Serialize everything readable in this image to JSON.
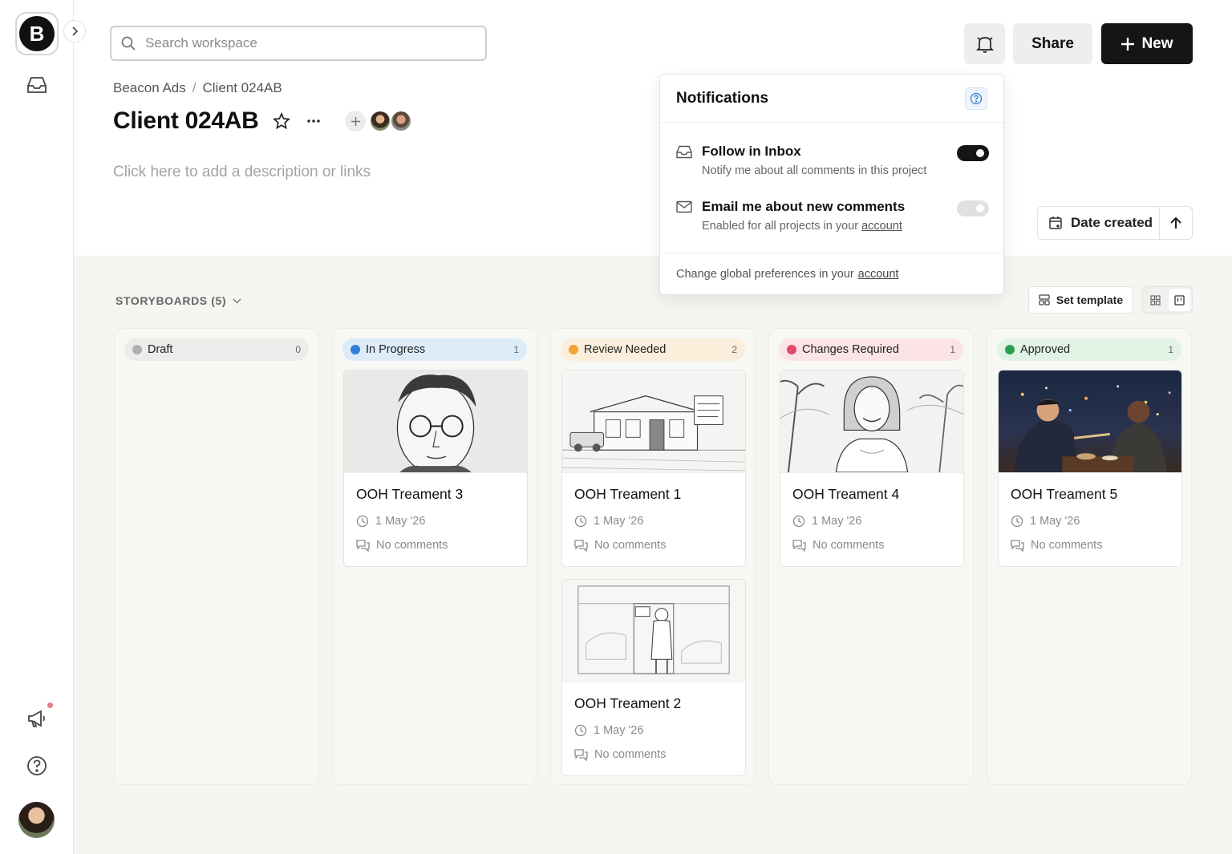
{
  "sidebar": {
    "logo_letter": "B",
    "items": [
      {
        "icon": "inbox-icon"
      },
      {
        "icon": "megaphone-icon",
        "has_badge": true
      },
      {
        "icon": "help-icon"
      },
      {
        "icon": "user-avatar"
      }
    ]
  },
  "header": {
    "search_placeholder": "Search workspace",
    "share_label": "Share",
    "new_label": "New",
    "breadcrumb": [
      "Beacon Ads",
      "Client 024AB"
    ],
    "title": "Client 024AB",
    "description_placeholder": "Click here to add a description or links",
    "sort_label": "Date created"
  },
  "notifications": {
    "title": "Notifications",
    "rows": [
      {
        "title": "Follow in Inbox",
        "subtitle": "Notify me about all comments in this project",
        "enabled": true
      },
      {
        "title": "Email me about new comments",
        "subtitle": "Enabled for all projects in your",
        "link": "account",
        "enabled": false
      }
    ],
    "footer_text": "Change global preferences in your",
    "footer_link": "account"
  },
  "board": {
    "title": "STORYBOARDS (5)",
    "set_template_label": "Set template",
    "columns": [
      {
        "label": "Draft",
        "count": "0",
        "dot": "#b0b0b0",
        "bg": "#ececea",
        "cards": []
      },
      {
        "label": "In Progress",
        "count": "1",
        "dot": "#2f7fd6",
        "bg": "#dcebf8",
        "cards": [
          {
            "title": "OOH Treament 3",
            "date": "1 May '26",
            "comments": "No comments"
          }
        ]
      },
      {
        "label": "Review Needed",
        "count": "2",
        "dot": "#f0a531",
        "bg": "#fbeedb",
        "cards": [
          {
            "title": "OOH Treament 1",
            "date": "1 May '26",
            "comments": "No comments"
          },
          {
            "title": "OOH Treament 2",
            "date": "1 May '26",
            "comments": "No comments"
          }
        ]
      },
      {
        "label": "Changes Required",
        "count": "1",
        "dot": "#e04a6c",
        "bg": "#fbe3e7",
        "cards": [
          {
            "title": "OOH Treament 4",
            "date": "1 May '26",
            "comments": "No comments"
          }
        ]
      },
      {
        "label": "Approved",
        "count": "1",
        "dot": "#2a9e4c",
        "bg": "#e0f3e5",
        "cards": [
          {
            "title": "OOH Treament 5",
            "date": "1 May '26",
            "comments": "No comments"
          }
        ]
      }
    ]
  },
  "colors": {
    "accent_dark": "#151515",
    "muted_text": "#8a8a8a"
  }
}
